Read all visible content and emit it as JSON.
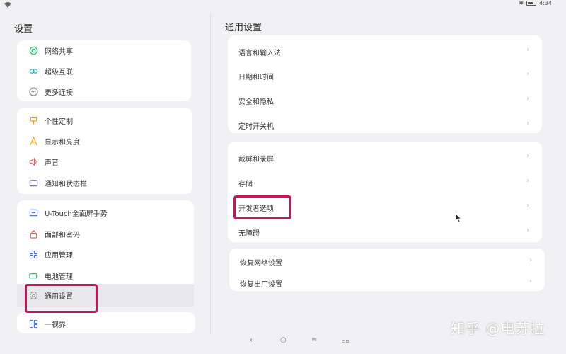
{
  "status": {
    "time": "4:34",
    "bluetooth_icon": "bluetooth-icon",
    "battery_icon": "battery-icon",
    "wifi_icon": "wifi-icon"
  },
  "left": {
    "title": "设置",
    "groups": [
      {
        "items": [
          {
            "label": "网络共享",
            "icon": "hotspot-icon"
          },
          {
            "label": "超级互联",
            "icon": "link-icon"
          },
          {
            "label": "更多连接",
            "icon": "more-icon"
          }
        ]
      },
      {
        "items": [
          {
            "label": "个性定制",
            "icon": "brush-icon"
          },
          {
            "label": "显示和亮度",
            "icon": "display-icon"
          },
          {
            "label": "声音",
            "icon": "speaker-icon"
          },
          {
            "label": "通知和状态栏",
            "icon": "notification-icon"
          }
        ]
      },
      {
        "items": [
          {
            "label": "U-Touch全面屏手势",
            "icon": "gesture-icon"
          },
          {
            "label": "面部和密码",
            "icon": "lock-icon"
          },
          {
            "label": "应用管理",
            "icon": "apps-icon"
          },
          {
            "label": "电池管理",
            "icon": "battery-manage-icon"
          },
          {
            "label": "通用设置",
            "icon": "gear-icon"
          }
        ]
      },
      {
        "items": [
          {
            "label": "一视界",
            "icon": "split-view-icon"
          }
        ]
      }
    ],
    "selected": "通用设置"
  },
  "right": {
    "title": "通用设置",
    "groups": [
      {
        "items": [
          {
            "label": "语言和输入法"
          },
          {
            "label": "日期和时间"
          },
          {
            "label": "安全和隐私"
          },
          {
            "label": "定时开关机"
          }
        ]
      },
      {
        "items": [
          {
            "label": "截屏和录屏"
          },
          {
            "label": "存储"
          },
          {
            "label": "开发者选项"
          },
          {
            "label": "无障碍"
          }
        ]
      },
      {
        "items": [
          {
            "label": "恢复网络设置"
          },
          {
            "label": "恢复出厂设置"
          }
        ]
      }
    ],
    "chevron": "›"
  },
  "nav": {
    "back": "‹",
    "home": "○",
    "menu": "≡",
    "recents": "▫▫"
  },
  "watermark": "知乎 @电苏拉",
  "colors": {
    "highlight": "#c2185b",
    "background": "#f1f1f3",
    "card": "#ffffff",
    "selected_row": "#e8e8ea"
  }
}
